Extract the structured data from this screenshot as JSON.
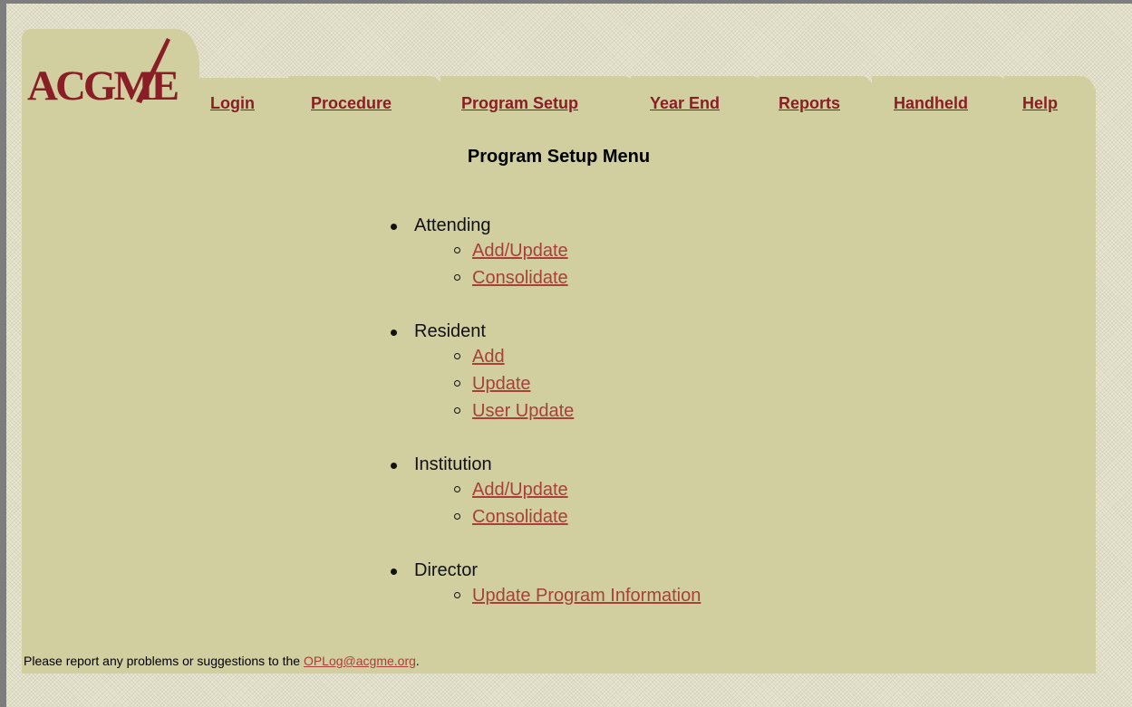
{
  "logo": {
    "text": "ACGME"
  },
  "nav": {
    "tabs": [
      {
        "label": "Login"
      },
      {
        "label": "Procedure"
      },
      {
        "label": "Program Setup"
      },
      {
        "label": "Year End"
      },
      {
        "label": "Reports"
      },
      {
        "label": "Handheld"
      },
      {
        "label": "Help"
      }
    ]
  },
  "page": {
    "title": "Program Setup Menu"
  },
  "menu": {
    "sections": [
      {
        "label": "Attending",
        "links": [
          "Add/Update",
          "Consolidate"
        ]
      },
      {
        "label": "Resident",
        "links": [
          "Add",
          "Update",
          "User Update"
        ]
      },
      {
        "label": "Institution",
        "links": [
          "Add/Update",
          "Consolidate"
        ]
      },
      {
        "label": "Director",
        "links": [
          "Update Program Information"
        ]
      }
    ]
  },
  "footer": {
    "text": "Please report any problems or suggestions to the ",
    "email": "OPLog@acgme.org",
    "suffix": "."
  },
  "colors": {
    "panel": "#d1cfa0",
    "brand": "#8a1e26",
    "link": "#a8403a"
  }
}
